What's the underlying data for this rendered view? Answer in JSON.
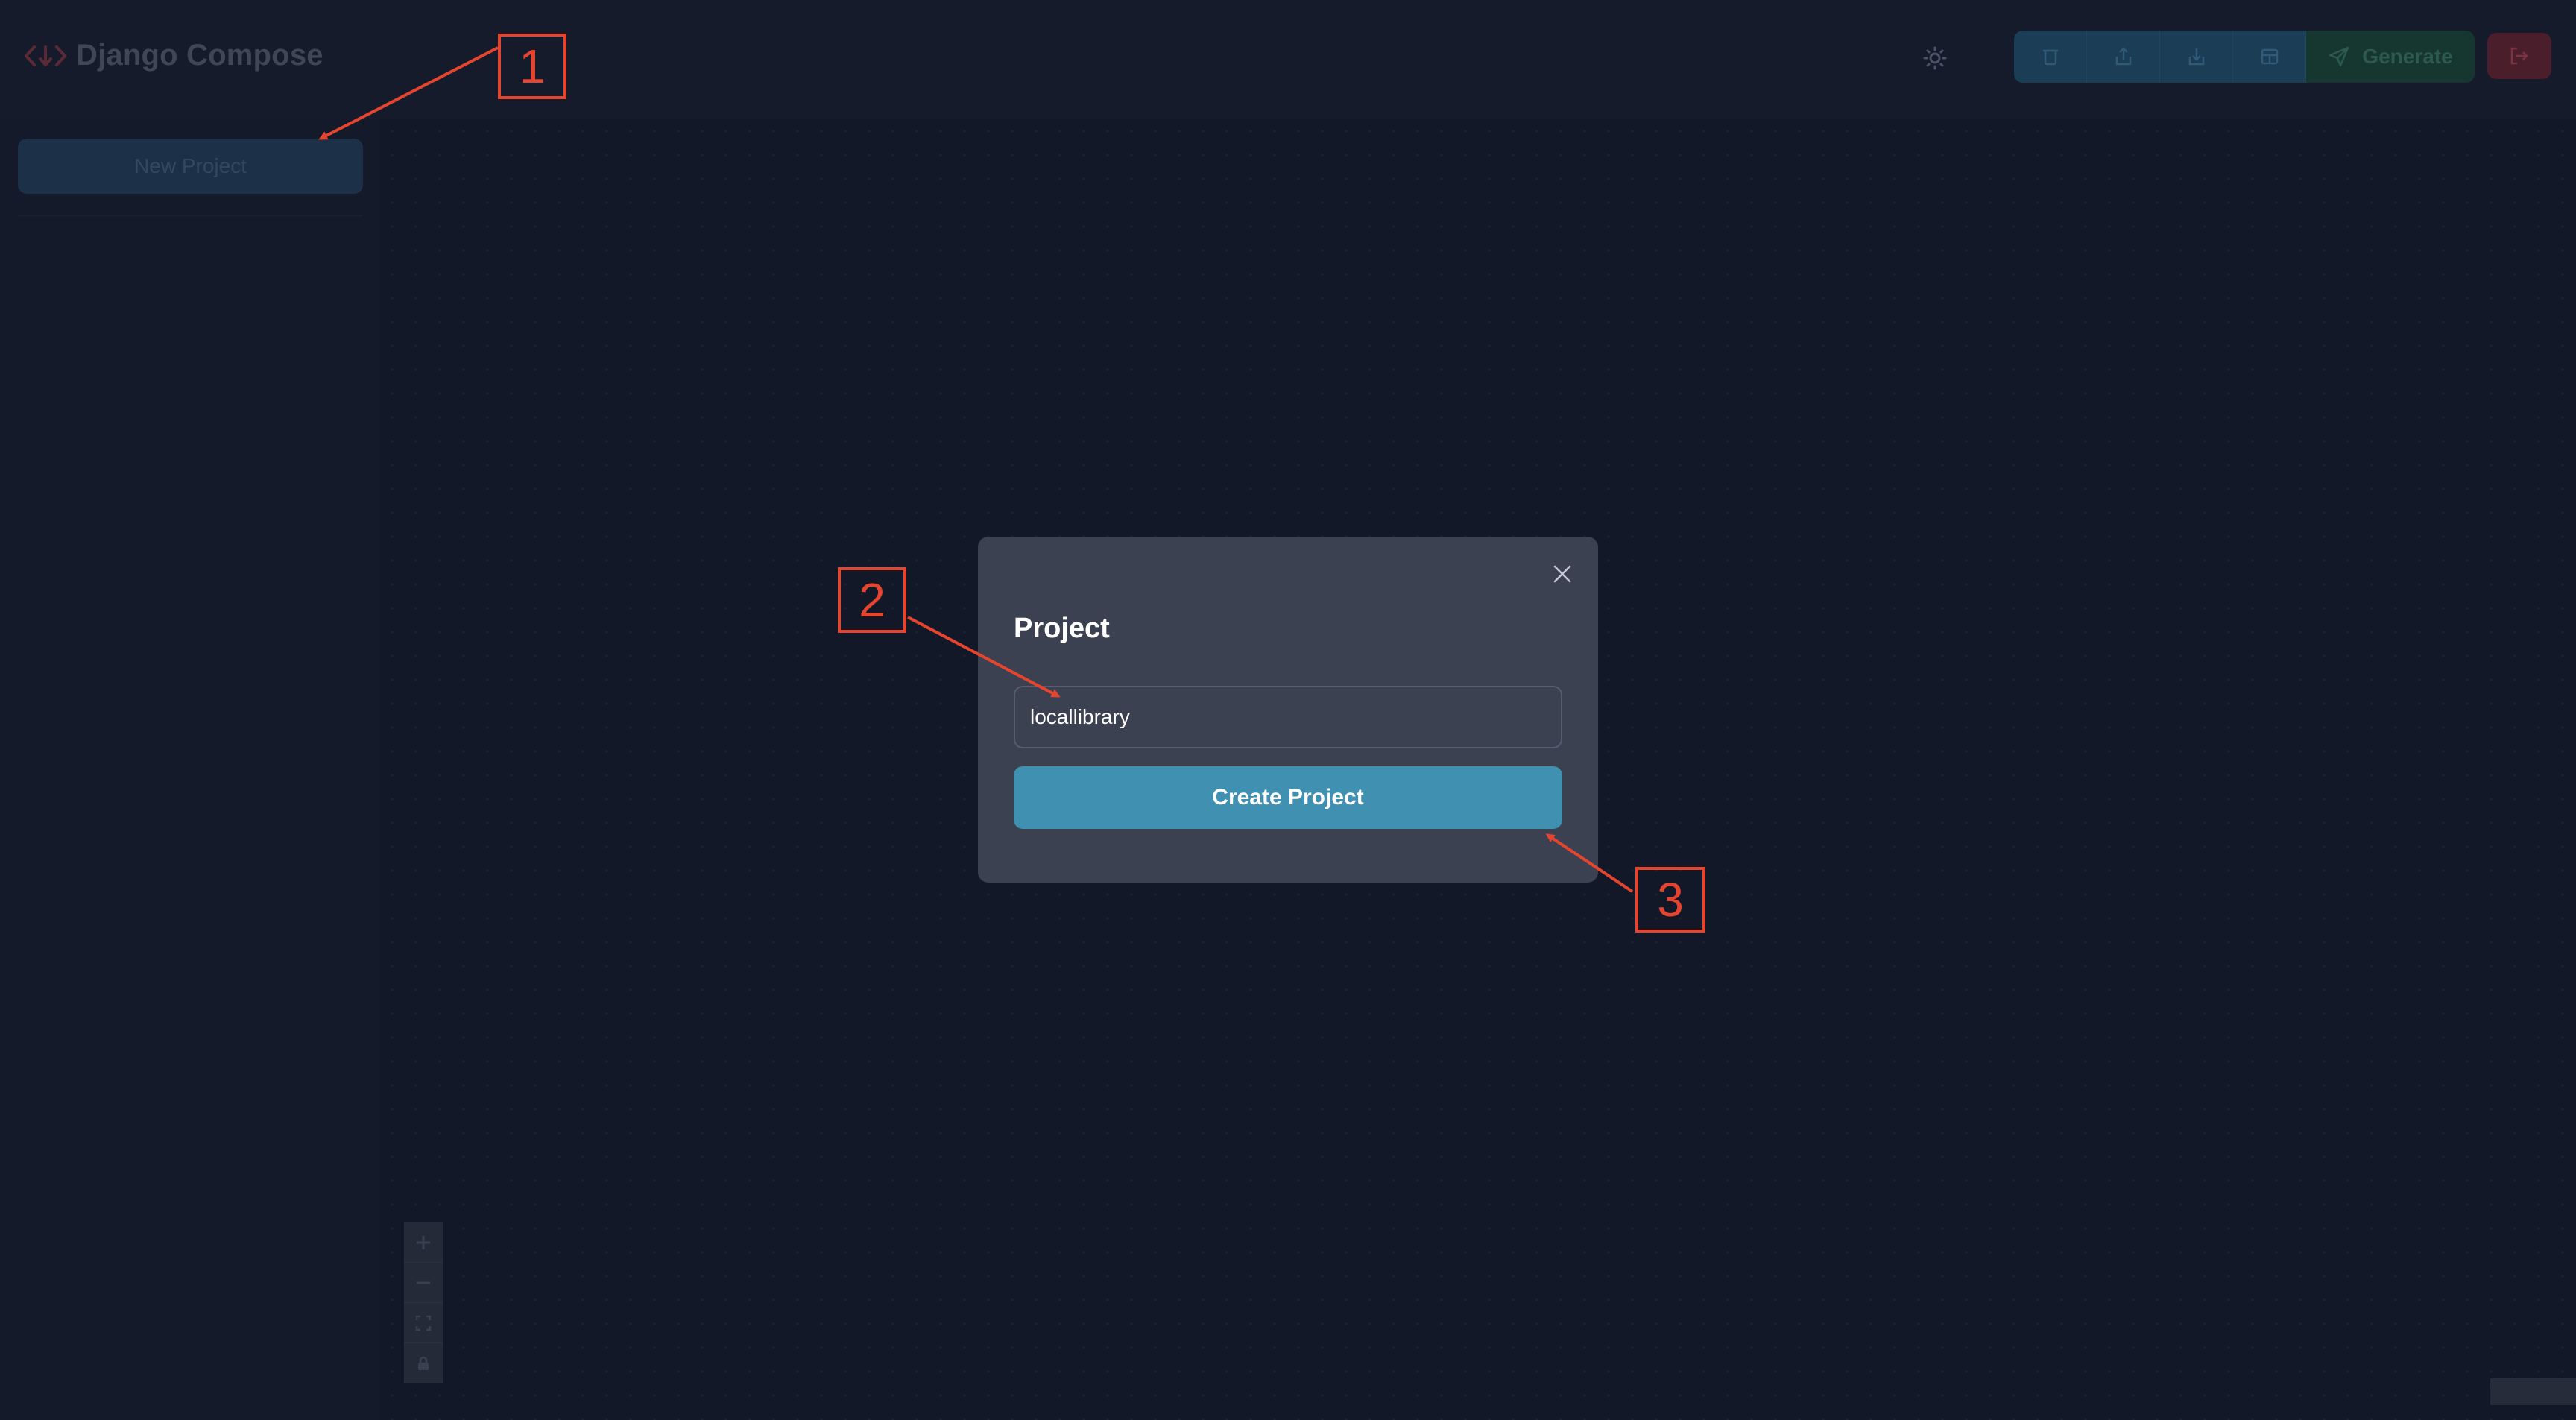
{
  "header": {
    "app_title": "Django Compose",
    "logo_icon": "code-brackets-icon",
    "theme_icon": "sun-icon",
    "toolbar": {
      "delete_icon": "trash-icon",
      "export_icon": "upload-icon",
      "import_icon": "download-icon",
      "layout_icon": "layout-template-icon",
      "generate_label": "Generate",
      "generate_icon": "send-icon"
    },
    "logout_icon": "logout-icon"
  },
  "sidebar": {
    "new_project_label": "New Project"
  },
  "canvas": {
    "controls": [
      "zoom-in",
      "zoom-out",
      "fit-view",
      "lock"
    ]
  },
  "modal": {
    "title": "Project",
    "input_value": "locallibrary",
    "submit_label": "Create Project",
    "close_icon": "close-icon"
  },
  "annotations": [
    {
      "label": "1"
    },
    {
      "label": "2"
    },
    {
      "label": "3"
    }
  ],
  "colors": {
    "background": "#131928",
    "modal": "#3c4152",
    "primary_button": "#3f90b1",
    "annotation": "#e5452e"
  }
}
